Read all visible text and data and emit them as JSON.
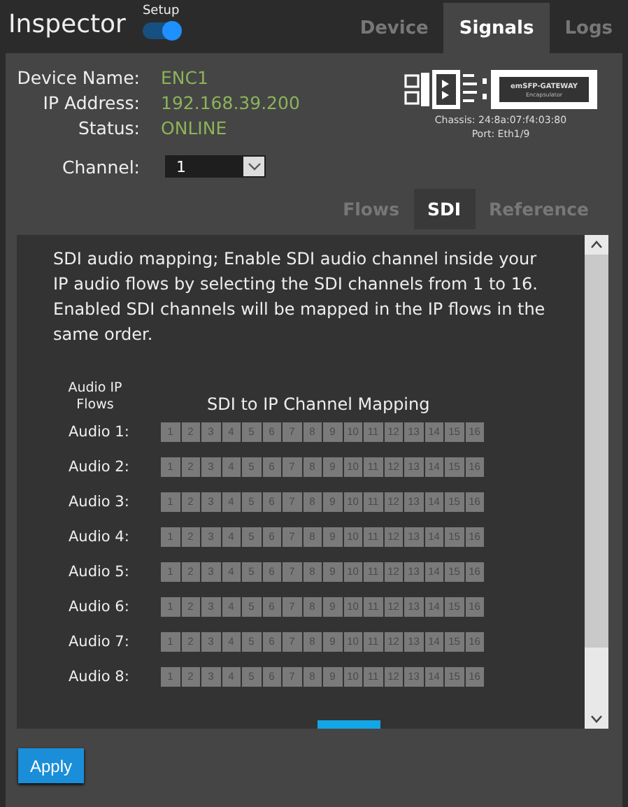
{
  "header": {
    "title": "Inspector",
    "setup_toggle": {
      "label": "Setup",
      "on": true
    }
  },
  "tabs": [
    {
      "label": "Device",
      "selected": false
    },
    {
      "label": "Signals",
      "selected": true
    },
    {
      "label": "Logs",
      "selected": false
    }
  ],
  "device": {
    "fields": [
      {
        "label": "Device Name:",
        "value": "ENC1"
      },
      {
        "label": "IP Address:",
        "value": "192.168.39.200"
      },
      {
        "label": "Status:",
        "value": "ONLINE"
      }
    ],
    "module": {
      "name": "emSFP-GATEWAY",
      "subtitle": "Encapsulator"
    },
    "chassis": "Chassis: 24:8a:07:f4:03:80",
    "port": "Port: Eth1/9"
  },
  "channel": {
    "label": "Channel:",
    "value": "1"
  },
  "sub_tabs": [
    {
      "label": "Flows",
      "selected": false
    },
    {
      "label": "SDI",
      "selected": true
    },
    {
      "label": "Reference",
      "selected": false
    }
  ],
  "sdi": {
    "description": "SDI audio mapping; Enable SDI audio channel inside your IP audio flows by selecting the SDI channels from 1 to 16. Enabled SDI channels will be mapped in the IP flows in the same order.",
    "flows_heading": "Audio IP Flows",
    "mapping_heading": "SDI to IP Channel Mapping",
    "rows": [
      {
        "label": "Audio 1:",
        "channels": [
          {
            "label": "1",
            "checked": false
          },
          {
            "label": "2",
            "checked": false
          },
          {
            "label": "3",
            "checked": false
          },
          {
            "label": "4",
            "checked": false
          },
          {
            "label": "5",
            "checked": false
          },
          {
            "label": "6",
            "checked": false
          },
          {
            "label": "7",
            "checked": false
          },
          {
            "label": "8",
            "checked": false
          },
          {
            "label": "9",
            "checked": false
          },
          {
            "label": "10",
            "checked": false
          },
          {
            "label": "11",
            "checked": false
          },
          {
            "label": "12",
            "checked": false
          },
          {
            "label": "13",
            "checked": false
          },
          {
            "label": "14",
            "checked": false
          },
          {
            "label": "15",
            "checked": false
          },
          {
            "label": "16",
            "checked": false
          }
        ]
      },
      {
        "label": "Audio 2:",
        "channels": [
          {
            "label": "1",
            "checked": false
          },
          {
            "label": "2",
            "checked": false
          },
          {
            "label": "3",
            "checked": false
          },
          {
            "label": "4",
            "checked": false
          },
          {
            "label": "5",
            "checked": false
          },
          {
            "label": "6",
            "checked": false
          },
          {
            "label": "7",
            "checked": false
          },
          {
            "label": "8",
            "checked": false
          },
          {
            "label": "9",
            "checked": false
          },
          {
            "label": "10",
            "checked": false
          },
          {
            "label": "11",
            "checked": false
          },
          {
            "label": "12",
            "checked": false
          },
          {
            "label": "13",
            "checked": false
          },
          {
            "label": "14",
            "checked": false
          },
          {
            "label": "15",
            "checked": false
          },
          {
            "label": "16",
            "checked": false
          }
        ]
      },
      {
        "label": "Audio 3:",
        "channels": [
          {
            "label": "1",
            "checked": false
          },
          {
            "label": "2",
            "checked": false
          },
          {
            "label": "3",
            "checked": false
          },
          {
            "label": "4",
            "checked": false
          },
          {
            "label": "5",
            "checked": false
          },
          {
            "label": "6",
            "checked": false
          },
          {
            "label": "7",
            "checked": false
          },
          {
            "label": "8",
            "checked": false
          },
          {
            "label": "9",
            "checked": false
          },
          {
            "label": "10",
            "checked": false
          },
          {
            "label": "11",
            "checked": false
          },
          {
            "label": "12",
            "checked": false
          },
          {
            "label": "13",
            "checked": false
          },
          {
            "label": "14",
            "checked": false
          },
          {
            "label": "15",
            "checked": false
          },
          {
            "label": "16",
            "checked": false
          }
        ]
      },
      {
        "label": "Audio 4:",
        "channels": [
          {
            "label": "1",
            "checked": false
          },
          {
            "label": "2",
            "checked": false
          },
          {
            "label": "3",
            "checked": false
          },
          {
            "label": "4",
            "checked": false
          },
          {
            "label": "5",
            "checked": false
          },
          {
            "label": "6",
            "checked": false
          },
          {
            "label": "7",
            "checked": false
          },
          {
            "label": "8",
            "checked": false
          },
          {
            "label": "9",
            "checked": false
          },
          {
            "label": "10",
            "checked": false
          },
          {
            "label": "11",
            "checked": false
          },
          {
            "label": "12",
            "checked": false
          },
          {
            "label": "13",
            "checked": false
          },
          {
            "label": "14",
            "checked": false
          },
          {
            "label": "15",
            "checked": false
          },
          {
            "label": "16",
            "checked": false
          }
        ]
      },
      {
        "label": "Audio 5:",
        "channels": [
          {
            "label": "1",
            "checked": false
          },
          {
            "label": "2",
            "checked": false
          },
          {
            "label": "3",
            "checked": false
          },
          {
            "label": "4",
            "checked": false
          },
          {
            "label": "5",
            "checked": false
          },
          {
            "label": "6",
            "checked": false
          },
          {
            "label": "7",
            "checked": false
          },
          {
            "label": "8",
            "checked": false
          },
          {
            "label": "9",
            "checked": false
          },
          {
            "label": "10",
            "checked": false
          },
          {
            "label": "11",
            "checked": false
          },
          {
            "label": "12",
            "checked": false
          },
          {
            "label": "13",
            "checked": false
          },
          {
            "label": "14",
            "checked": false
          },
          {
            "label": "15",
            "checked": false
          },
          {
            "label": "16",
            "checked": false
          }
        ]
      },
      {
        "label": "Audio 6:",
        "channels": [
          {
            "label": "1",
            "checked": false
          },
          {
            "label": "2",
            "checked": false
          },
          {
            "label": "3",
            "checked": false
          },
          {
            "label": "4",
            "checked": false
          },
          {
            "label": "5",
            "checked": false
          },
          {
            "label": "6",
            "checked": false
          },
          {
            "label": "7",
            "checked": false
          },
          {
            "label": "8",
            "checked": false
          },
          {
            "label": "9",
            "checked": false
          },
          {
            "label": "10",
            "checked": false
          },
          {
            "label": "11",
            "checked": false
          },
          {
            "label": "12",
            "checked": false
          },
          {
            "label": "13",
            "checked": false
          },
          {
            "label": "14",
            "checked": false
          },
          {
            "label": "15",
            "checked": false
          },
          {
            "label": "16",
            "checked": false
          }
        ]
      },
      {
        "label": "Audio 7:",
        "channels": [
          {
            "label": "1",
            "checked": false
          },
          {
            "label": "2",
            "checked": false
          },
          {
            "label": "3",
            "checked": false
          },
          {
            "label": "4",
            "checked": false
          },
          {
            "label": "5",
            "checked": false
          },
          {
            "label": "6",
            "checked": false
          },
          {
            "label": "7",
            "checked": false
          },
          {
            "label": "8",
            "checked": false
          },
          {
            "label": "9",
            "checked": false
          },
          {
            "label": "10",
            "checked": false
          },
          {
            "label": "11",
            "checked": false
          },
          {
            "label": "12",
            "checked": false
          },
          {
            "label": "13",
            "checked": false
          },
          {
            "label": "14",
            "checked": false
          },
          {
            "label": "15",
            "checked": false
          },
          {
            "label": "16",
            "checked": false
          }
        ]
      },
      {
        "label": "Audio 8:",
        "channels": [
          {
            "label": "1",
            "checked": false
          },
          {
            "label": "2",
            "checked": false
          },
          {
            "label": "3",
            "checked": false
          },
          {
            "label": "4",
            "checked": false
          },
          {
            "label": "5",
            "checked": false
          },
          {
            "label": "6",
            "checked": false
          },
          {
            "label": "7",
            "checked": false
          },
          {
            "label": "8",
            "checked": false
          },
          {
            "label": "9",
            "checked": false
          },
          {
            "label": "10",
            "checked": false
          },
          {
            "label": "11",
            "checked": false
          },
          {
            "label": "12",
            "checked": false
          },
          {
            "label": "13",
            "checked": false
          },
          {
            "label": "14",
            "checked": false
          },
          {
            "label": "15",
            "checked": false
          },
          {
            "label": "16",
            "checked": false
          }
        ]
      }
    ]
  },
  "apply_button": "Apply"
}
